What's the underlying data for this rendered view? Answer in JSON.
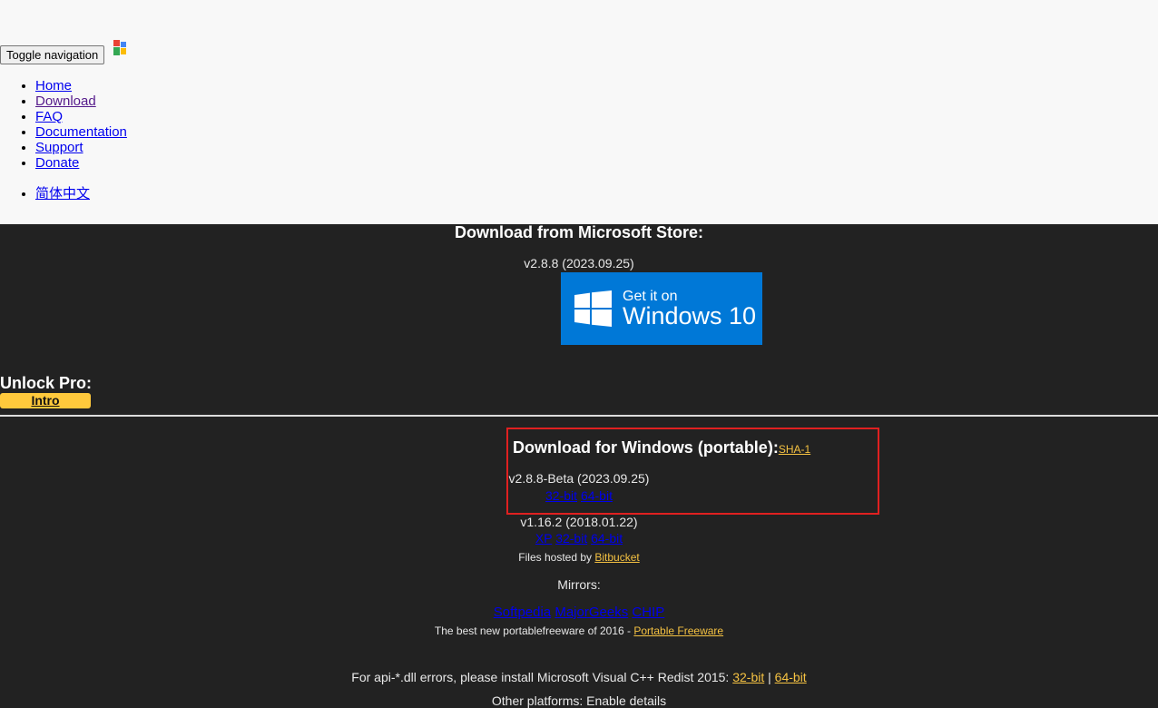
{
  "navbar": {
    "toggle_label": "Toggle navigation",
    "brand": "Snipaste",
    "items": [
      {
        "label": "Home"
      },
      {
        "label": "Download"
      },
      {
        "label": "FAQ"
      },
      {
        "label": "Documentation"
      },
      {
        "label": "Support"
      },
      {
        "label": "Donate"
      }
    ],
    "language": "简体中文"
  },
  "store": {
    "heading": "Download from Microsoft Store:",
    "version": "v2.8.8 (2023.09.25)",
    "badge_line1": "Get it on",
    "badge_line2": "Windows 10",
    "badge_color": "#0078d7"
  },
  "pro": {
    "heading": "Unlock Pro:",
    "intro_label": "Intro",
    "accent": "#ffc93c"
  },
  "portable": {
    "heading": "Download for Windows (portable):",
    "sha_label": "SHA-1",
    "beta_version": "v2.8.8-Beta (2023.09.25)",
    "beta_links": [
      "32-bit",
      "64-bit"
    ],
    "old_version": "v1.16.2 (2018.01.22)",
    "old_links": [
      "XP",
      "32-bit",
      "64-bit"
    ],
    "hosted_prefix": "Files hosted by ",
    "hosted_link": "Bitbucket",
    "mirrors_label": "Mirrors:",
    "mirror_links": [
      "Softpedia",
      "MajorGeeks",
      "CHIP"
    ],
    "award_prefix": "The best new portablefreeware of 2016 - ",
    "award_link": "Portable Freeware",
    "redist_text": "For api-*.dll errors, please install Microsoft Visual C++ Redist 2015: ",
    "redist_links": [
      "32-bit",
      "64-bit"
    ],
    "redist_sep": " | ",
    "cut_text": "Other platforms: Enable details"
  },
  "highlight_color": "#e02020"
}
